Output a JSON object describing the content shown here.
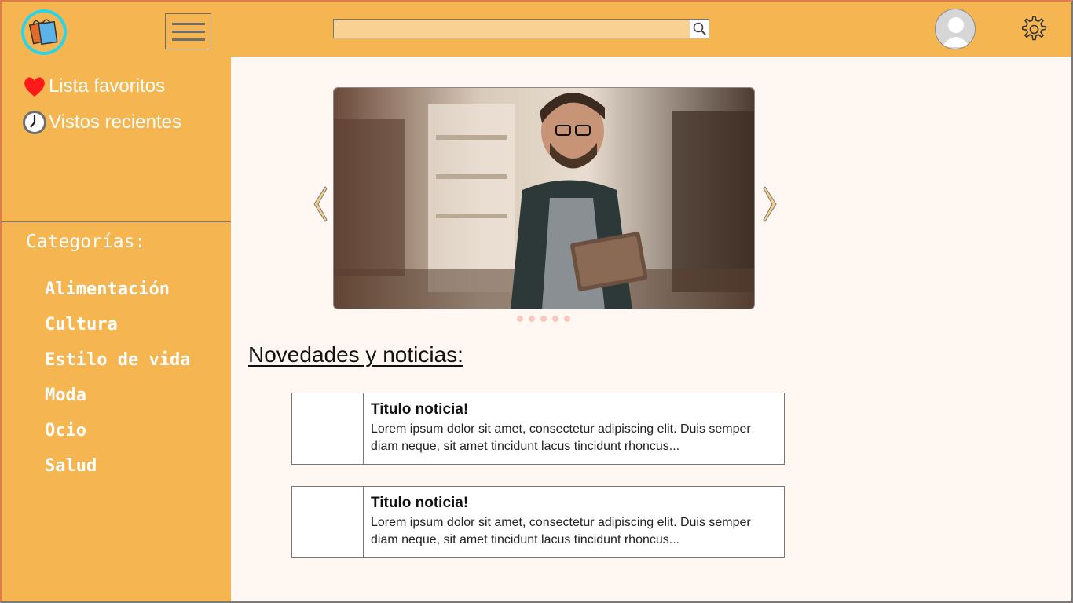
{
  "header": {
    "logo_icon": "shopping-bags-icon",
    "menu_icon": "hamburger-menu-icon",
    "search": {
      "value": "",
      "placeholder": "",
      "icon": "search-icon"
    },
    "profile_icon": "user-avatar-icon",
    "settings_icon": "gear-icon"
  },
  "sidebar": {
    "favorites": {
      "label": "Lista favoritos",
      "icon": "heart-icon"
    },
    "recent": {
      "label": "Vistos recientes",
      "icon": "clock-icon"
    },
    "categories_title": "Categorías:",
    "categories": [
      "Alimentación",
      "Cultura",
      "Estilo de vida",
      "Moda",
      "Ocio",
      "Salud"
    ]
  },
  "carousel": {
    "prev_icon": "chevron-left-icon",
    "next_icon": "chevron-right-icon",
    "slide_count": 5
  },
  "news": {
    "heading": "Novedades y noticias:",
    "items": [
      {
        "title": "Titulo noticia!",
        "body": "Lorem ipsum dolor sit amet, consectetur adipiscing elit. Duis semper diam neque, sit amet tincidunt lacus tincidunt rhoncus..."
      },
      {
        "title": "Titulo noticia!",
        "body": "Lorem ipsum dolor sit amet, consectetur adipiscing elit. Duis semper diam neque, sit amet tincidunt lacus tincidunt rhoncus..."
      }
    ]
  },
  "colors": {
    "accent": "#f5b651",
    "background": "#fff8f2",
    "heart": "#ff1a1a",
    "logo_ring": "#2ad4e8"
  }
}
